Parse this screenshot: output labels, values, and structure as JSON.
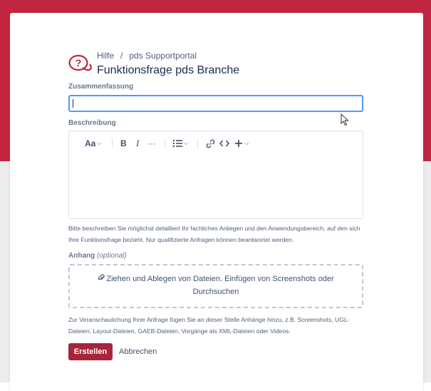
{
  "header": {
    "breadcrumb": [
      "Hilfe",
      "/",
      "pds Supportportal"
    ],
    "title": "Funktionsfrage pds Branche"
  },
  "form": {
    "summary_label": "Zusammenfassung",
    "summary_value": "",
    "description_label": "Beschreibung",
    "toolbar": {
      "text_style": "Aa",
      "bold": "B",
      "italic": "I",
      "more": "···"
    },
    "description_help": "Bitte beschreiben Sie möglichst detailliert Ihr fachliches Anliegen und den Anwendungsbereich, auf den sich Ihre Funktionsfrage bezieht. Nur qualifizierte Anfragen können beantwortet werden.",
    "attachment_label": "Anhang",
    "attachment_optional": "(optional)",
    "dropzone_text": "Ziehen und Ablegen von Dateien. Einfügen von Screenshots oder",
    "dropzone_browse": "Durchsuchen",
    "attachment_help": "Zur Veranschaulichung Ihrer Anfrage fügen Sie an dieser Stelle Anhänge hinzu, z.B. Screenshots, UGL-Dateien, Layout-Dateien, GAEB-Dateien, Vorgänge als XML-Dateien oder Videos.",
    "submit_label": "Erstellen",
    "cancel_label": "Abbrechen"
  },
  "colors": {
    "banner": "#c1253f",
    "primary_button": "#a8243b",
    "focus_border": "#4c9aff"
  },
  "icons": [
    "question-chat-icon",
    "chevron-down-icon",
    "bullet-list-icon",
    "link-icon",
    "code-icon",
    "plus-icon",
    "paperclip-icon",
    "mouse-cursor-icon"
  ]
}
